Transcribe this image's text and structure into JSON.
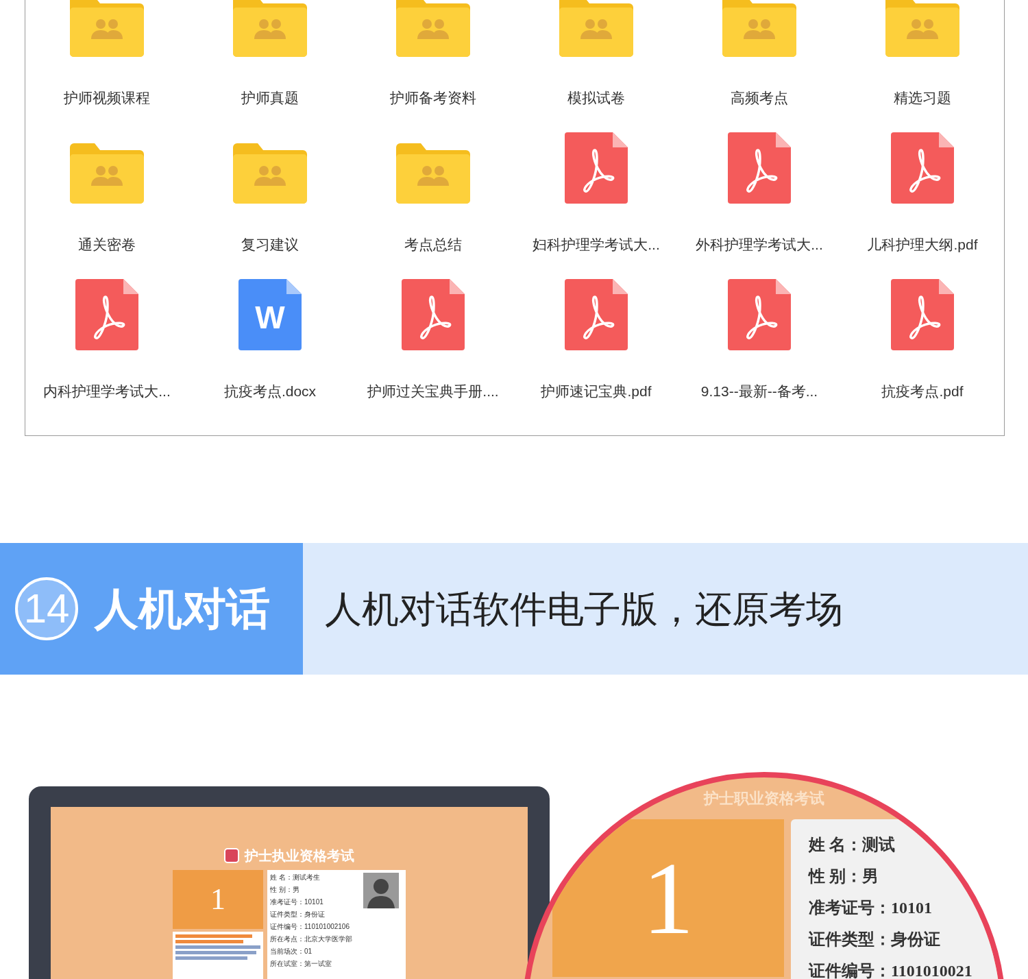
{
  "files": [
    {
      "kind": "folder",
      "name": "护师视频课程"
    },
    {
      "kind": "folder",
      "name": "护师真题"
    },
    {
      "kind": "folder",
      "name": "护师备考资料"
    },
    {
      "kind": "folder",
      "name": "模拟试卷"
    },
    {
      "kind": "folder",
      "name": "高频考点"
    },
    {
      "kind": "folder",
      "name": "精选习题"
    },
    {
      "kind": "folder",
      "name": "通关密卷"
    },
    {
      "kind": "folder",
      "name": "复习建议"
    },
    {
      "kind": "folder",
      "name": "考点总结"
    },
    {
      "kind": "pdf",
      "name": "妇科护理学考试大..."
    },
    {
      "kind": "pdf",
      "name": "外科护理学考试大..."
    },
    {
      "kind": "pdf",
      "name": "儿科护理大纲.pdf"
    },
    {
      "kind": "pdf",
      "name": "内科护理学考试大..."
    },
    {
      "kind": "word",
      "name": "抗疫考点.docx",
      "icon_text": "W"
    },
    {
      "kind": "pdf",
      "name": "护师过关宝典手册...."
    },
    {
      "kind": "pdf",
      "name": "护师速记宝典.pdf"
    },
    {
      "kind": "pdf",
      "name": "9.13--最新--备考..."
    },
    {
      "kind": "pdf",
      "name": "抗疫考点.pdf"
    }
  ],
  "banner": {
    "number": "14",
    "title": "人机对话",
    "subtitle": "人机对话软件电子版，还原考场"
  },
  "monitor": {
    "title": "护士执业资格考试",
    "question_number": "1",
    "info": [
      "姓 名：测试考生",
      "性 别：男",
      "准考证号：10101",
      "证件类型：身份证",
      "证件编号：110101002106",
      "所在考点：北京大学医学部",
      "当前场次：01",
      "所在试室：第一试室"
    ]
  },
  "magnifier": {
    "title": "护士职业资格考试",
    "question_number": "1",
    "info": [
      "姓 名：测试",
      "性 别：男",
      "准考证号：10101",
      "证件类型：身份证",
      "证件编号：1101010021"
    ]
  }
}
